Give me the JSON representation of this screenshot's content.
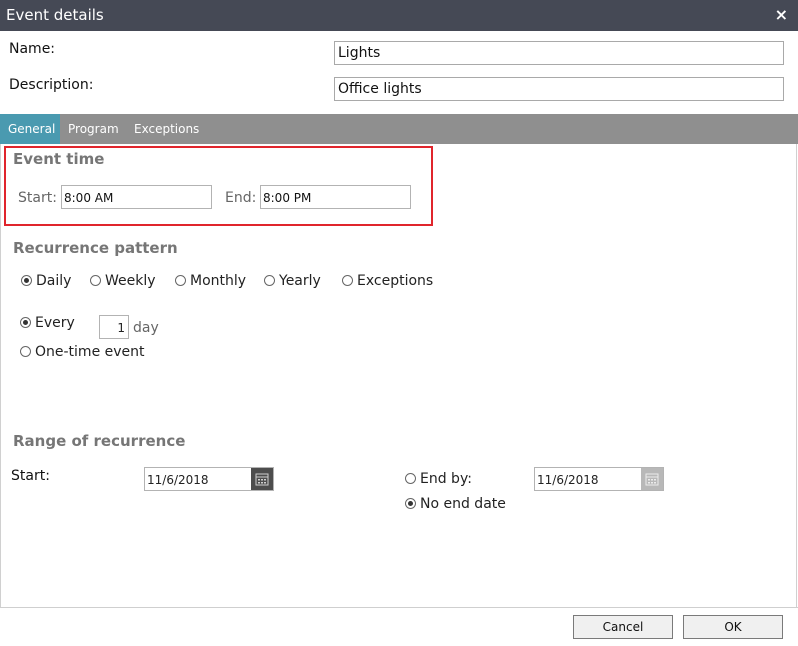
{
  "window": {
    "title": "Event details",
    "close_glyph": "×"
  },
  "fields": {
    "name_label": "Name:",
    "name_value": "Lights",
    "description_label": "Description:",
    "description_value": "Office lights"
  },
  "tabs": [
    {
      "label": "General",
      "active": true
    },
    {
      "label": "Program",
      "active": false
    },
    {
      "label": "Exceptions",
      "active": false
    }
  ],
  "event_time": {
    "heading": "Event time",
    "start_label": "Start:",
    "start_value": "8:00 AM",
    "end_label": "End:",
    "end_value": "8:00 PM"
  },
  "recurrence_pattern": {
    "heading": "Recurrence pattern",
    "options": [
      {
        "label": "Daily",
        "selected": true
      },
      {
        "label": "Weekly",
        "selected": false
      },
      {
        "label": "Monthly",
        "selected": false
      },
      {
        "label": "Yearly",
        "selected": false
      },
      {
        "label": "Exceptions",
        "selected": false
      }
    ],
    "every_label": "Every",
    "every_value": "1",
    "every_unit": "day",
    "one_time_label": "One-time event",
    "every_selected": true
  },
  "range": {
    "heading": "Range of recurrence",
    "start_label": "Start:",
    "start_date": "11/6/2018",
    "end_by_label": "End by:",
    "end_by_date": "11/6/2018",
    "no_end_label": "No end date",
    "no_end_selected": true
  },
  "footer": {
    "cancel_label": "Cancel",
    "ok_label": "OK"
  },
  "colors": {
    "titlebar": "#454955",
    "tab_active": "#4a9ab0",
    "tabbar": "#8f8f8f",
    "highlight": "#e0252c"
  }
}
